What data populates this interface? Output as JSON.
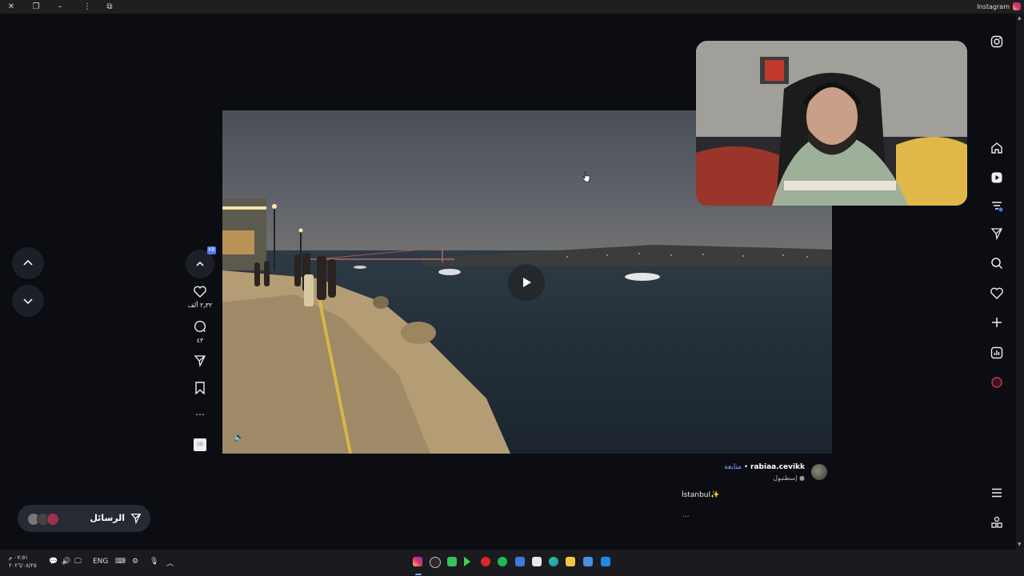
{
  "window": {
    "title": "Instagram"
  },
  "post": {
    "likes": "٢٫٣٢ ألف",
    "comments": "٤٣",
    "author": "rabiaa.cevikk",
    "follow_label": "متابعة",
    "separator": "•",
    "location": "إسطنبول",
    "caption": "İstanbul✨",
    "more": "..."
  },
  "actions": {
    "up_badge": "KB",
    "save_thumb": "SB"
  },
  "messages": {
    "label": "الرسائل"
  },
  "taskbar": {
    "time": "٠٧:٥١ م",
    "date": "٢٠٢٦/٠٨/٢٥",
    "language": "ENG"
  },
  "colors": {
    "accent": "#4b78f5",
    "follow": "#7aa7ff",
    "background": "#0b0d12"
  },
  "icons": {
    "rightbar": [
      "instagram-icon",
      "home-icon",
      "reels-icon",
      "filter-icon",
      "send-icon",
      "search-icon",
      "heart-icon",
      "plus-icon",
      "stats-icon",
      "profile-icon",
      "menu-icon",
      "apps-icon"
    ]
  }
}
